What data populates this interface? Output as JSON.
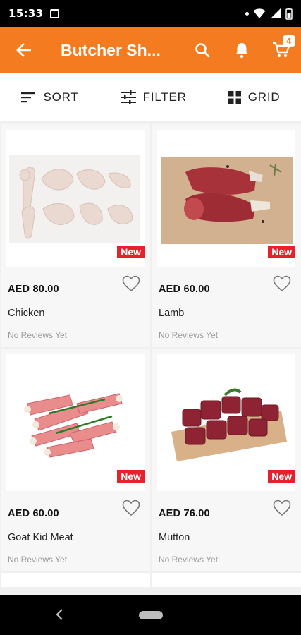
{
  "status": {
    "time": "15:33"
  },
  "header": {
    "title": "Butcher Sh...",
    "cart_count": "4"
  },
  "toolbar": {
    "sort": "SORT",
    "filter": "FILTER",
    "grid": "GRID"
  },
  "colors": {
    "brand": "#f47b20",
    "badge": "#e8202a"
  },
  "products": [
    {
      "price": "AED 80.00",
      "name": "Chicken",
      "reviews": "No Reviews Yet",
      "badge": "New"
    },
    {
      "price": "AED 60.00",
      "name": "Lamb",
      "reviews": "No Reviews Yet",
      "badge": "New"
    },
    {
      "price": "AED 60.00",
      "name": "Goat Kid Meat",
      "reviews": "No Reviews Yet",
      "badge": "New"
    },
    {
      "price": "AED 76.00",
      "name": "Mutton",
      "reviews": "No Reviews Yet",
      "badge": "New"
    }
  ]
}
